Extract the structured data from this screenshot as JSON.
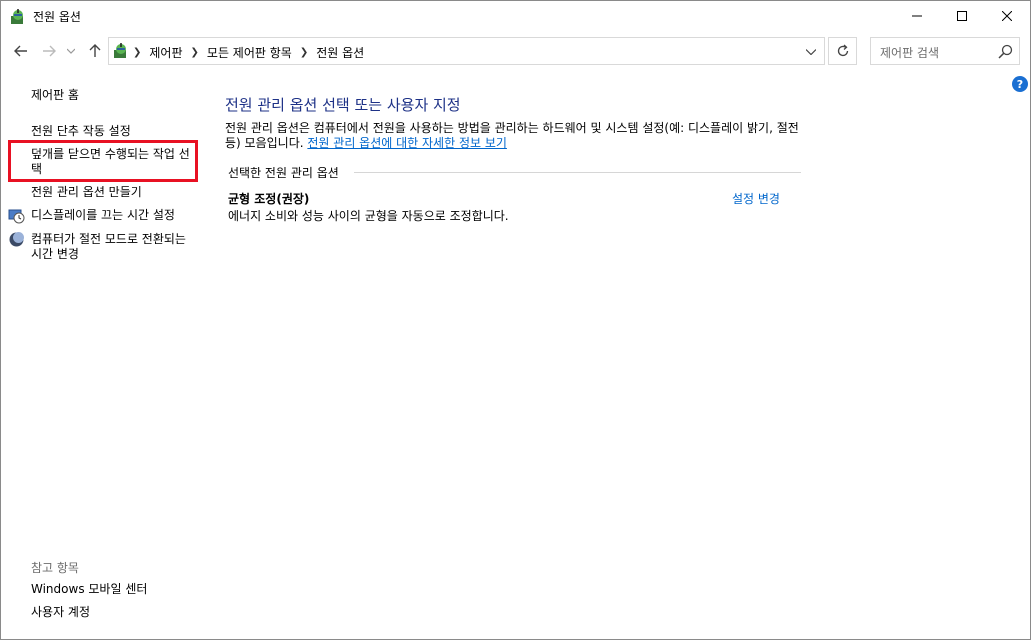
{
  "window": {
    "title": "전원 옵션"
  },
  "address": {
    "crumbs": [
      "제어판",
      "모든 제어판 항목",
      "전원 옵션"
    ]
  },
  "search": {
    "placeholder": "제어판 검색"
  },
  "help": {
    "label": "?"
  },
  "sidebar": {
    "home": "제어판 홈",
    "items": [
      "전원 단추 작동 설정",
      "덮개를 닫으면 수행되는 작업 선택",
      "전원 관리 옵션 만들기",
      "디스플레이를 끄는 시간 설정",
      "컴퓨터가 절전 모드로 전환되는 시간 변경"
    ],
    "see_also_label": "참고 항목",
    "see_also_items": [
      "Windows 모바일 센터",
      "사용자 계정"
    ],
    "highlight_color": "#e81123"
  },
  "main": {
    "title": "전원 관리 옵션 선택 또는 사용자 지정",
    "description": "전원 관리 옵션은 컴퓨터에서 전원을 사용하는 방법을 관리하는 하드웨어 및 시스템 설정(예: 디스플레이 밝기, 절전 등) 모음입니다.",
    "description_link": "전원 관리 옵션에 대한 자세한 정보 보기",
    "section_label": "선택한 전원 관리 옵션",
    "plan_name": "균형 조정(권장)",
    "plan_description": "에너지 소비와 성능 사이의 균형을 자동으로 조정합니다.",
    "plan_change": "설정 변경"
  },
  "colors": {
    "title_blue": "#1e3287",
    "link_blue": "#0066cc"
  }
}
